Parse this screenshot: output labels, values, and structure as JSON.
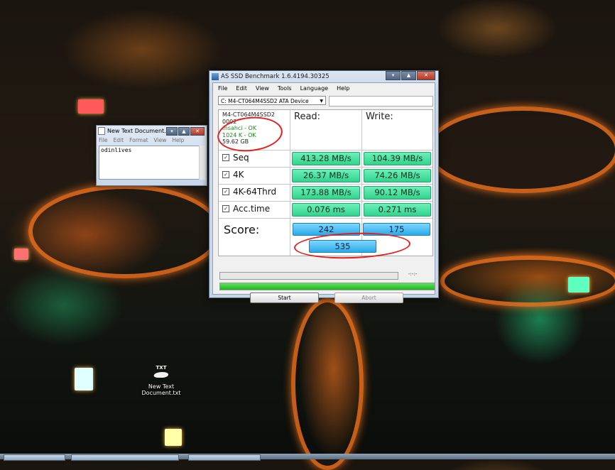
{
  "notepad": {
    "title": "New Text Document...",
    "menu": [
      "File",
      "Edit",
      "Format",
      "View",
      "Help"
    ],
    "content": "odinlives",
    "controls": {
      "minimize": "▾",
      "maximize": "▲",
      "close": "✕"
    }
  },
  "ssd": {
    "title": "AS SSD Benchmark 1.6.4194.30325",
    "controls": {
      "minimize": "▾",
      "maximize": "▲",
      "close": "✕"
    },
    "menu": [
      "File",
      "Edit",
      "View",
      "Tools",
      "Language",
      "Help"
    ],
    "drive": "C: M4-CT064M4SSD2 ATA Device",
    "info": {
      "model": "M4-CT064M4SSD2",
      "firmware": "0002",
      "driver": "msahci - OK",
      "alignment": "1024 K - OK",
      "size": "59.62 GB"
    },
    "headers": {
      "read": "Read:",
      "write": "Write:"
    },
    "tests": [
      {
        "label": "Seq",
        "read": "413.28 MB/s",
        "write": "104.39 MB/s"
      },
      {
        "label": "4K",
        "read": "26.37 MB/s",
        "write": "74.26 MB/s"
      },
      {
        "label": "4K-64Thrd",
        "read": "173.88 MB/s",
        "write": "90.12 MB/s"
      },
      {
        "label": "Acc.time",
        "read": "0.076 ms",
        "write": "0.271 ms"
      }
    ],
    "score": {
      "label": "Score:",
      "read": "242",
      "write": "175",
      "total": "535"
    },
    "timer": "-:-:-",
    "progress_complete": 1.0,
    "buttons": {
      "start": "Start",
      "abort": "Abort"
    }
  },
  "desktop_icon": {
    "tag": "TXT",
    "label": "New Text Document.txt"
  },
  "colors": {
    "value_green": "#2fd38e",
    "score_blue": "#2aaae8",
    "annotation_red": "#e81d1d"
  }
}
